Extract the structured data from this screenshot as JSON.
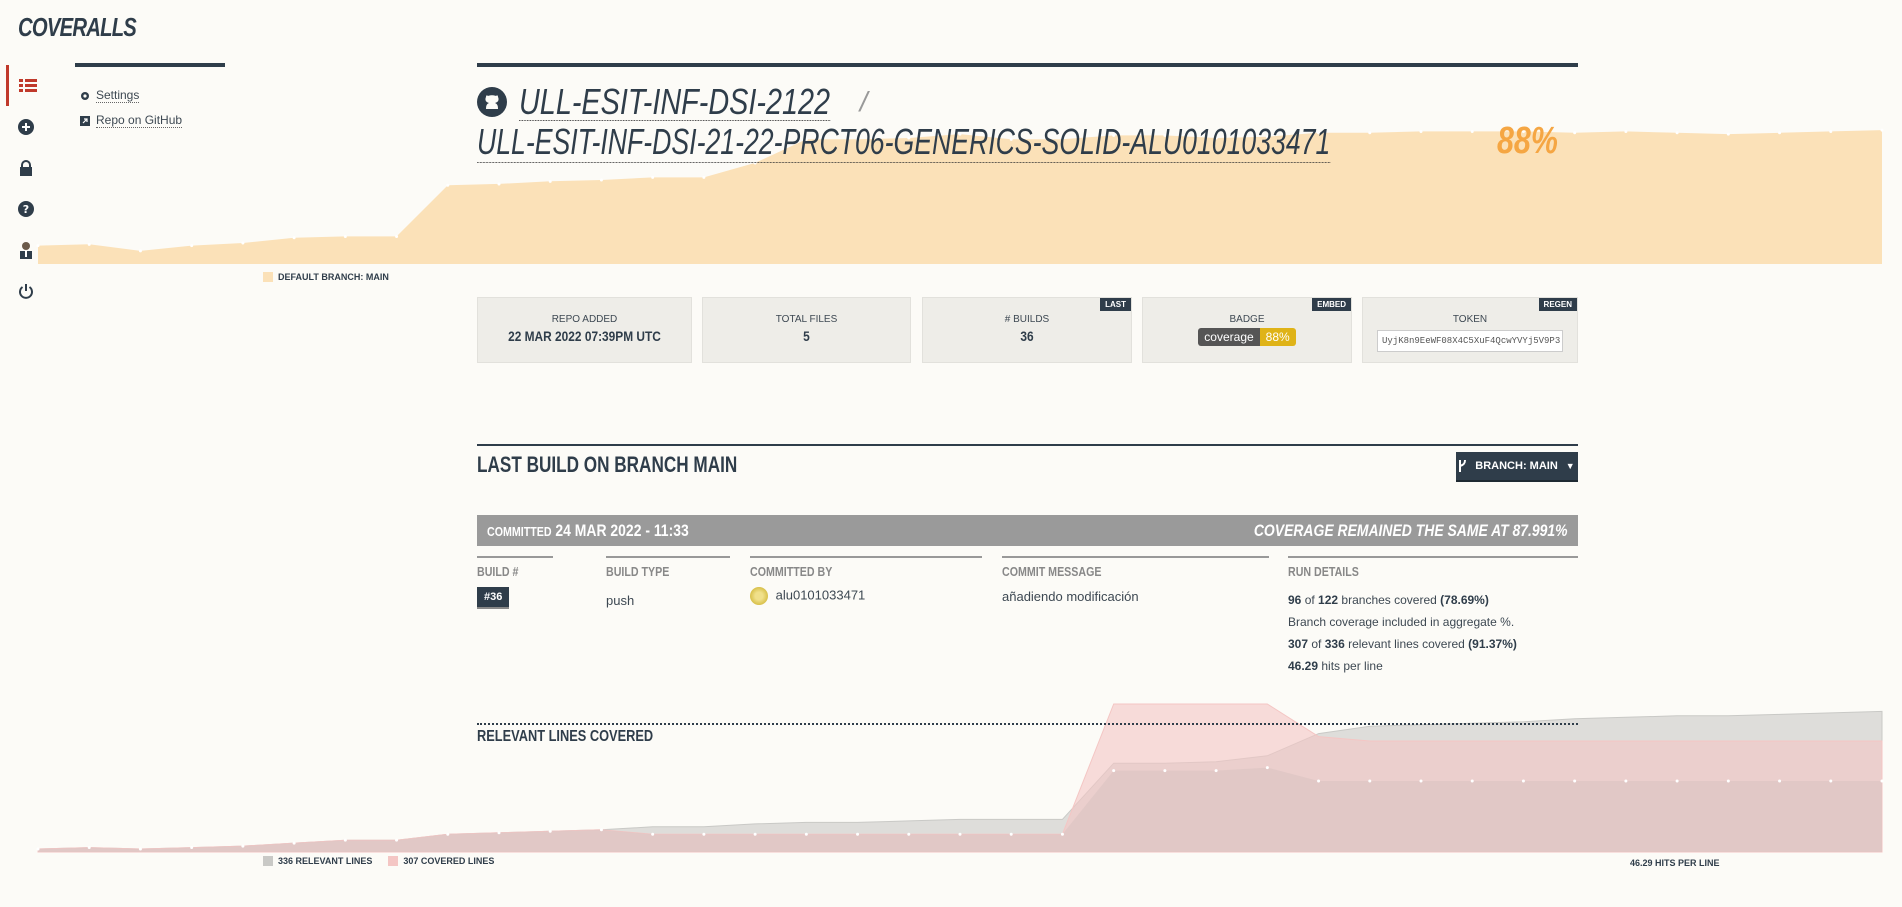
{
  "app": {
    "logo": "COVERALLS"
  },
  "rail_icons": [
    "list-icon",
    "plus-circle-icon",
    "lock-icon",
    "question-icon",
    "user-avatar",
    "power-icon"
  ],
  "sidebar": {
    "settings_label": "Settings",
    "github_label": "Repo on GitHub"
  },
  "repo": {
    "org": "ULL-ESIT-INF-DSI-2122",
    "separator": "/",
    "name": "ULL-ESIT-INF-DSI-21-22-PRCT06-GENERICS-SOLID-ALU0101033471",
    "coverage_pct": "88%"
  },
  "coverage_chart": {
    "legend": "DEFAULT BRANCH: MAIN",
    "color": "#fbe1b8",
    "values": [
      14,
      15,
      10,
      14,
      16,
      20,
      21,
      21,
      60,
      61,
      63,
      64,
      66,
      66,
      77,
      95,
      95,
      96,
      99,
      95,
      95,
      98,
      98,
      96,
      97,
      100,
      100,
      101,
      101,
      101,
      100,
      101,
      100,
      99,
      100,
      101,
      102
    ],
    "ymax": 160
  },
  "stats": {
    "repo_added_label": "REPO ADDED",
    "repo_added_value": "22 MAR 2022 07:39PM UTC",
    "total_files_label": "TOTAL FILES",
    "total_files_value": "5",
    "builds_label": "# BUILDS",
    "builds_value": "36",
    "builds_tag": "LAST",
    "badge_label": "BADGE",
    "badge_tag": "EMBED",
    "badge_left": "coverage",
    "badge_right": "88%",
    "token_label": "TOKEN",
    "token_tag": "REGEN",
    "token_value": "UyjK8n9EeWF08X4C5XuF4QcwYVYj5V9P3"
  },
  "last_build": {
    "title": "LAST BUILD ON BRANCH MAIN",
    "branch_button": "BRANCH: MAIN",
    "committed_prefix": "COMMITTED",
    "committed_date": "24 MAR 2022 - 11:33",
    "coverage_message": "COVERAGE REMAINED THE SAME AT 87.991%",
    "cols": {
      "build_label": "BUILD #",
      "build_value": "#36",
      "type_label": "BUILD TYPE",
      "type_value": "push",
      "by_label": "COMMITTED BY",
      "by_value": "alu0101033471",
      "msg_label": "COMMIT MESSAGE",
      "msg_value": "añadiendo modificación",
      "run_label": "RUN DETAILS"
    },
    "run": {
      "branches_covered": "96",
      "branches_total": "122",
      "branches_pct": "(78.69%)",
      "branches_text": "branches covered",
      "branch_note": "Branch coverage included in aggregate %.",
      "lines_covered": "307",
      "lines_total": "336",
      "lines_text": "relevant lines covered",
      "lines_pct": "(91.37%)",
      "hits": "46.29",
      "hits_text": "hits per line"
    }
  },
  "lines_chart": {
    "title": "RELEVANT LINES COVERED",
    "relevant_legend": "336 RELEVANT LINES",
    "covered_legend": "307 COVERED LINES",
    "hits_legend": "46.29 HITS PER LINE",
    "relevant_color": "#c9c9c6",
    "covered_color": "#f4c6c4",
    "relevant": [
      2,
      3,
      2,
      3,
      4,
      6,
      8,
      8,
      12,
      13,
      14,
      15,
      17,
      17,
      19,
      20,
      20,
      21,
      22,
      22,
      22,
      60,
      60,
      61,
      65,
      80,
      85,
      86,
      87,
      88,
      90,
      91,
      92,
      92,
      93,
      94,
      95
    ],
    "covered": [
      2,
      3,
      2,
      3,
      4,
      6,
      8,
      8,
      12,
      13,
      14,
      15,
      12,
      12,
      12,
      12,
      12,
      12,
      12,
      12,
      12,
      100,
      100,
      100,
      100,
      78,
      75,
      75,
      75,
      75,
      75,
      75,
      75,
      75,
      75,
      75,
      75
    ],
    "covered_line": [
      2,
      3,
      2,
      3,
      4,
      6,
      8,
      8,
      12,
      13,
      14,
      15,
      12,
      12,
      12,
      12,
      12,
      12,
      12,
      12,
      12,
      55,
      55,
      55,
      57,
      48,
      48,
      48,
      48,
      48,
      48,
      48,
      48,
      48,
      48,
      48,
      48
    ],
    "ymax": 100
  }
}
